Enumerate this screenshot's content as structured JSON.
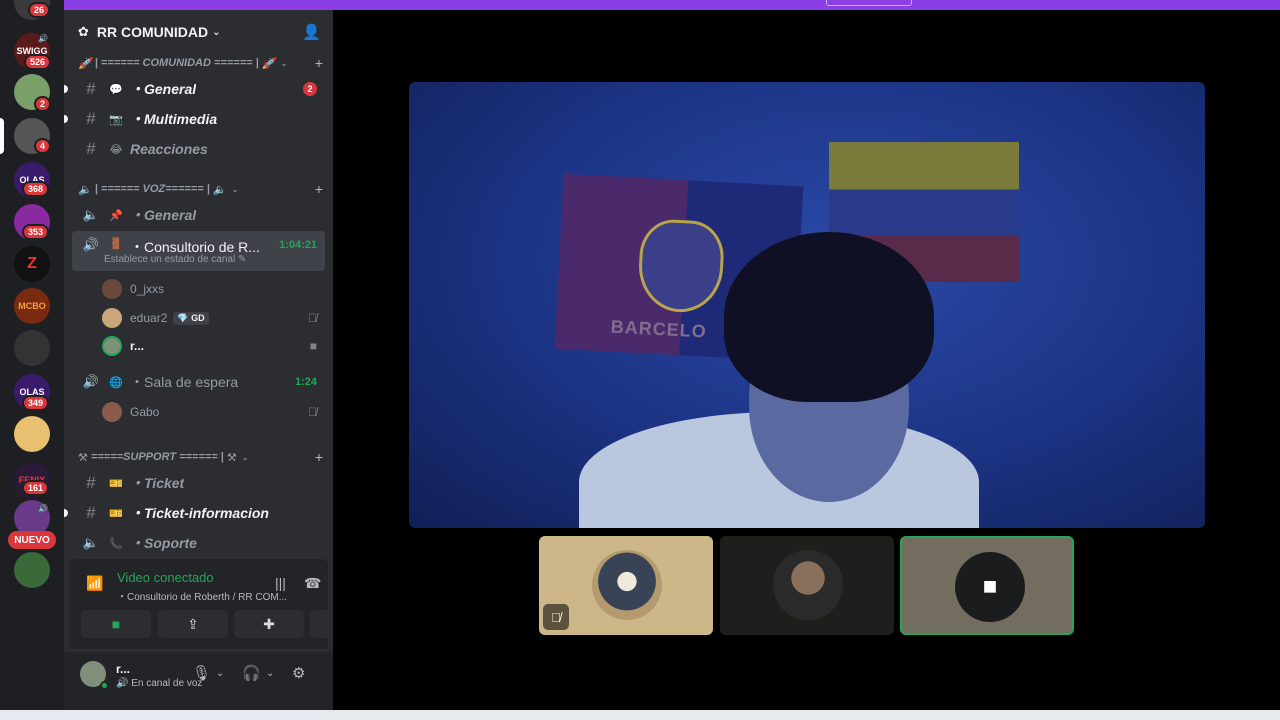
{
  "app": {
    "accent": "#8a3ee6",
    "voice_green": "#23a55a",
    "badge_red": "#da373c"
  },
  "rail": {
    "servers": [
      {
        "label": "",
        "badge": "26"
      },
      {
        "label": "SWIGG",
        "badge": "526"
      },
      {
        "label": "",
        "badge": "2"
      },
      {
        "label": "",
        "badge": "4"
      },
      {
        "label": "OLAS",
        "badge": "368"
      },
      {
        "label": "",
        "badge": "353"
      },
      {
        "label": "",
        "badge": ""
      },
      {
        "label": "MCBO",
        "badge": ""
      },
      {
        "label": "",
        "badge": ""
      },
      {
        "label": "OLAS",
        "badge": "349"
      },
      {
        "label": "",
        "badge": ""
      },
      {
        "label": "FENIX",
        "badge": "161"
      },
      {
        "label": "",
        "badge": ""
      }
    ],
    "nuevo_label": "NUEVO"
  },
  "server": {
    "name": "RR COMUNIDAD"
  },
  "categories": {
    "comunidad": "| ====== COMUNIDAD ====== |",
    "voz": "| ====== VOZ====== |",
    "support": "=====SUPPORT ====== |"
  },
  "channels": {
    "general_text": {
      "name": "・General",
      "badge": "2"
    },
    "multimedia": {
      "name": "・Multimedia"
    },
    "reacciones": {
      "name": "Reacciones"
    },
    "general_voice": {
      "name": "・General"
    },
    "consultorio": {
      "name": "・Consultorio de R...",
      "time": "1:04:21",
      "sub": "Establece un estado de canal"
    },
    "sala": {
      "name": "・Sala de espera",
      "time": "1:24"
    },
    "ticket": {
      "name": "・Ticket"
    },
    "ticket_info": {
      "name": "・Ticket-informacion"
    },
    "soporte": {
      "name": "・Soporte"
    }
  },
  "members": {
    "m1": {
      "name": "0_jxxs"
    },
    "m2": {
      "name": "eduar2",
      "tag": "GD"
    },
    "m3": {
      "name": "r..."
    },
    "m4": {
      "name": "Gabo"
    }
  },
  "voice_panel": {
    "title": "Video conectado",
    "subtitle": "・Consultorio de Roberth / RR COM..."
  },
  "user_panel": {
    "name": "r...",
    "status": "En canal de voz"
  }
}
